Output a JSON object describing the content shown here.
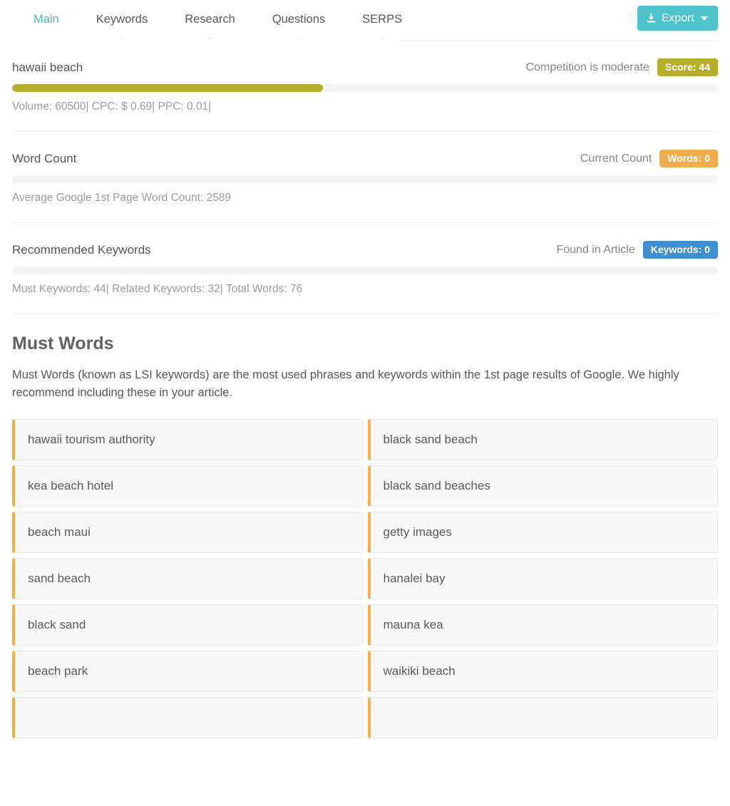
{
  "tabs": [
    {
      "label": "Main",
      "active": true
    },
    {
      "label": "Keywords",
      "active": false
    },
    {
      "label": "Research",
      "active": false
    },
    {
      "label": "Questions",
      "active": false
    },
    {
      "label": "SERPS",
      "active": false
    }
  ],
  "toolbar": {
    "export_label": "Export",
    "export_icon": "download-icon",
    "caret_icon": "caret-down-icon",
    "export_color": "#4ec3cb"
  },
  "competition": {
    "keyword": "hawaii beach",
    "status_text": "Competition is moderate",
    "badge_label": "Score: 44",
    "score": 44,
    "bar_percent": 44,
    "bar_color": "#b5ae2c",
    "meta": "Volume: 60500| CPC: $ 0.69| PPC: 0.01|"
  },
  "word_count": {
    "title": "Word Count",
    "status_text": "Current Count",
    "badge_label": "Words: 0",
    "count": 0,
    "bar_percent": 0,
    "badge_color": "#f0ad4e",
    "meta": "Average Google 1st Page Word Count: 2589"
  },
  "recommended_keywords": {
    "title": "Recommended Keywords",
    "status_text": "Found in Article",
    "badge_label": "Keywords: 0",
    "count": 0,
    "bar_percent": 0,
    "badge_color": "#3e8ed0",
    "meta": "Must Keywords: 44| Related Keywords: 32| Total Words: 76"
  },
  "must_words": {
    "title": "Must Words",
    "description": "Must Words (known as LSI keywords) are the most used phrases and keywords within the 1st page results of Google. We highly recommend including these in your article.",
    "accent_color": "#f0ad4e",
    "items": [
      "hawaii tourism authority",
      "black sand beach",
      "kea beach hotel",
      "black sand beaches",
      "beach maui",
      "getty images",
      "sand beach",
      "hanalei bay",
      "black sand",
      "mauna kea",
      "beach park",
      "waikiki beach",
      "",
      ""
    ]
  }
}
